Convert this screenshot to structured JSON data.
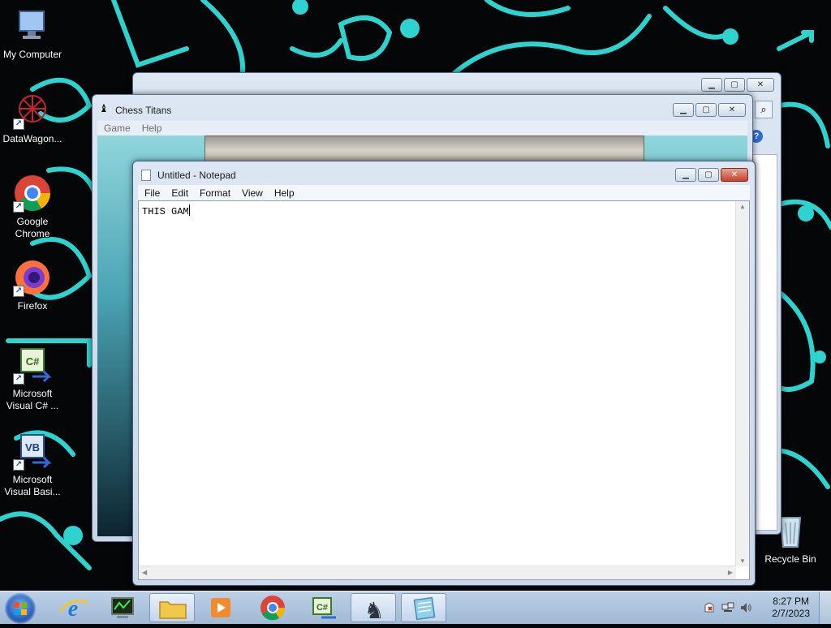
{
  "desktop": {
    "icons": [
      {
        "label": "My Computer"
      },
      {
        "label": "DataWagon..."
      },
      {
        "label": "Google Chrome"
      },
      {
        "label": "Firefox"
      },
      {
        "label": "Microsoft Visual C# ..."
      },
      {
        "label": "Microsoft Visual Basi..."
      },
      {
        "label": "Recycle Bin"
      }
    ]
  },
  "chess_window": {
    "title": "Chess Titans",
    "menu": [
      "Game",
      "Help"
    ]
  },
  "notepad": {
    "title": "Untitled - Notepad",
    "menu": [
      "File",
      "Edit",
      "Format",
      "View",
      "Help"
    ],
    "content": "THIS GAM"
  },
  "taskbar": {
    "pinned": [
      "internet-explorer",
      "task-manager",
      "windows-explorer",
      "media-center",
      "google-chrome",
      "visual-csharp",
      "chess-titans",
      "notepad"
    ],
    "time": "8:27 PM",
    "date": "2/7/2023"
  }
}
